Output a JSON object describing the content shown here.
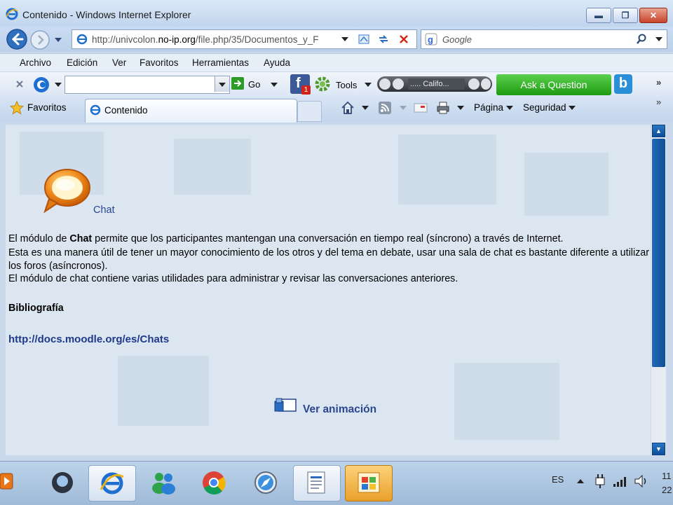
{
  "window": {
    "title": "Contenido - Windows Internet Explorer",
    "minimize": "▬",
    "maximize": "❐",
    "close": "✕"
  },
  "address": {
    "url_prefix": "http://univcolon.",
    "url_host": "no-ip.org",
    "url_rest": "/file.php/35/Documentos_y_F"
  },
  "search": {
    "placeholder": "Google"
  },
  "menu": [
    "Archivo",
    "Edición",
    "Ver",
    "Favoritos",
    "Herramientas",
    "Ayuda"
  ],
  "toolbar": {
    "go_label": "Go",
    "tools_label": "Tools",
    "media_label": "..... Califo...",
    "ask_label": "Ask a Question",
    "facebook_badge": "1"
  },
  "tabs": {
    "favorites_label": "Favoritos",
    "current_tab": "Contenido",
    "page_menu": "Página",
    "security_menu": "Seguridad"
  },
  "page": {
    "chat_label": "Chat",
    "para1_pre": "El módulo de ",
    "para1_bold": "Chat",
    "para1_post": " permite que los participantes mantengan una conversación en tiempo real (síncrono) a través de Internet.",
    "para2": "Esta es una manera útil de tener un mayor conocimiento de los otros y del tema en debate, usar una sala de chat es bastante diferente a utilizar los foros (asíncronos).",
    "para3": "El módulo de chat contiene varias utilidades para administrar y revisar las conversaciones anteriores.",
    "bibliography_heading": "Bibliografía",
    "bibliography_link": "http://docs.moodle.org/es/Chats",
    "animation_link": "Ver animación"
  },
  "taskbar": {
    "language": "ES",
    "clock_line1": "11",
    "clock_line2": "22"
  },
  "colors": {
    "link": "#1f3a8a",
    "ask_button": "#2fae22",
    "scroll_thumb": "#1a60ad"
  }
}
